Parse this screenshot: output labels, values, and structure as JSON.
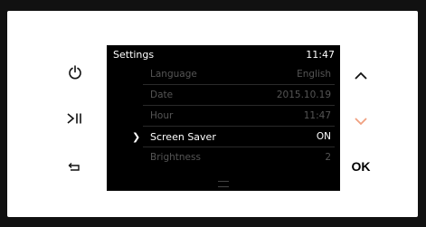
{
  "screen": {
    "title": "Settings",
    "clock": "11:47"
  },
  "menu": {
    "items": [
      {
        "label": "Language",
        "value": "English"
      },
      {
        "label": "Date",
        "value": "2015.10.19"
      },
      {
        "label": "Hour",
        "value": "11:47"
      },
      {
        "label": "Screen Saver",
        "value": "ON",
        "selected": true
      },
      {
        "label": "Brightness",
        "value": "2"
      }
    ],
    "selector_glyph": "❯"
  },
  "buttons": {
    "power": {
      "icon": "power-icon"
    },
    "play_pause": {
      "icon": "play-pause-icon"
    },
    "back": {
      "icon": "back-arrow-icon"
    },
    "up": {
      "icon": "chevron-up-icon"
    },
    "down": {
      "icon": "chevron-down-icon"
    },
    "ok_label": "OK"
  },
  "colors": {
    "down_arrow_accent": "#f0a080",
    "screen_bg": "#000000",
    "inactive_text": "#555555"
  }
}
